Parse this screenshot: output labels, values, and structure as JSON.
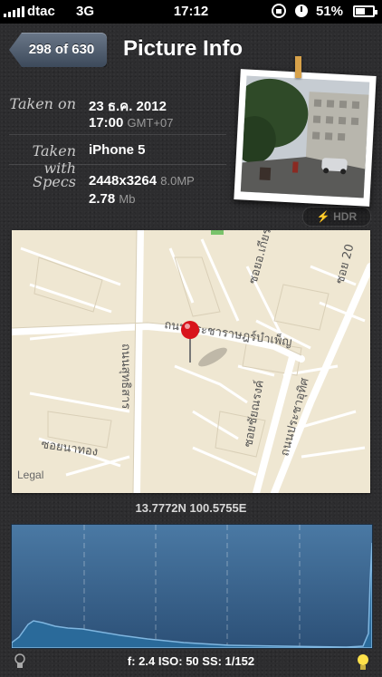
{
  "status": {
    "carrier": "dtac",
    "network": "3G",
    "time": "17:12",
    "battery": "51%"
  },
  "nav": {
    "back_label": "298 of 630",
    "title": "Picture Info"
  },
  "info": {
    "taken_on_label": "Taken on",
    "date": "23 ธ.ค. 2012",
    "time": "17:00",
    "timezone": "GMT+07",
    "taken_with_label": "Taken with",
    "device": "iPhone 5",
    "specs_label": "Specs",
    "resolution": "2448x3264",
    "megapixels": "8.0MP",
    "size": "2.78",
    "size_unit": "Mb"
  },
  "hdr_label": "HDR",
  "map": {
    "legal": "Legal",
    "streets": {
      "s1": "ถนนประชาราษฎร์บำเพ็ญ",
      "s2": "ถนนสุทธิสาร",
      "s3": "ซอยอ.เกียรติชัย",
      "s4": "ถนนประชาอุทิศ",
      "s5": "ซอยชัยณรงค์",
      "s6": "ซอยนาทอง",
      "s7": "ซอย 20"
    }
  },
  "coordinates": "13.7772N 100.5755E",
  "exif": "f: 2.4 ISO: 50 SS: 1/152",
  "colors": {
    "histogram_top": "#4a79a4",
    "histogram_bottom": "#2c5077",
    "map_bg": "#efe7d2",
    "pin": "#d8131b"
  }
}
